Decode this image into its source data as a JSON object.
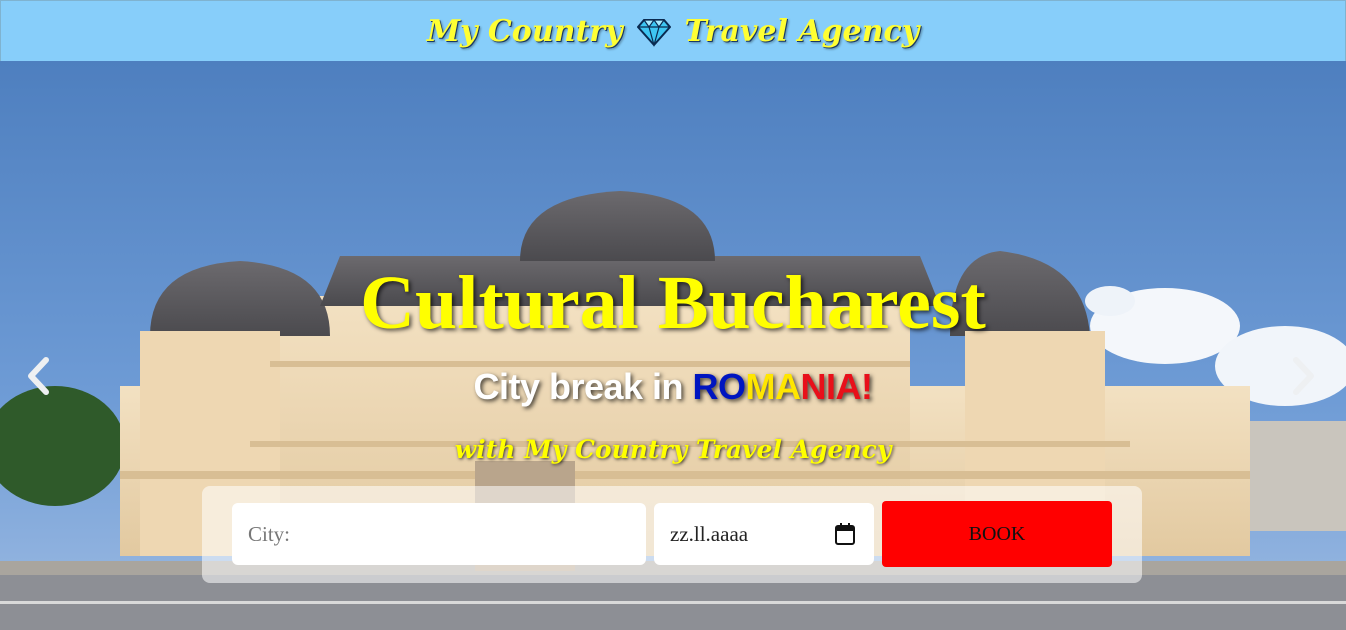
{
  "header": {
    "brand_left": "My Country",
    "brand_right": "Travel Agency",
    "gem_icon": "diamond-gem-icon"
  },
  "hero": {
    "title": "Cultural Bucharest",
    "subtitle_prefix": "City break in ",
    "subtitle_ro": "RO",
    "subtitle_ma": "MA",
    "subtitle_nia": "NIA!",
    "tagline": "with My Country Travel Agency",
    "prev_icon": "chevron-left-icon",
    "next_icon": "chevron-right-icon"
  },
  "booking": {
    "city_placeholder": "City:",
    "date_value": "zz.ll.aaaa",
    "calendar_icon": "calendar-icon",
    "book_label": "BOOK"
  },
  "colors": {
    "header_bg": "#87cefa",
    "brand_text": "#ffff33",
    "title_text": "#ffff00",
    "book_button": "#ff0000",
    "flag_blue": "#0015c0",
    "flag_yellow": "#ffe600",
    "flag_red": "#e8101a"
  }
}
